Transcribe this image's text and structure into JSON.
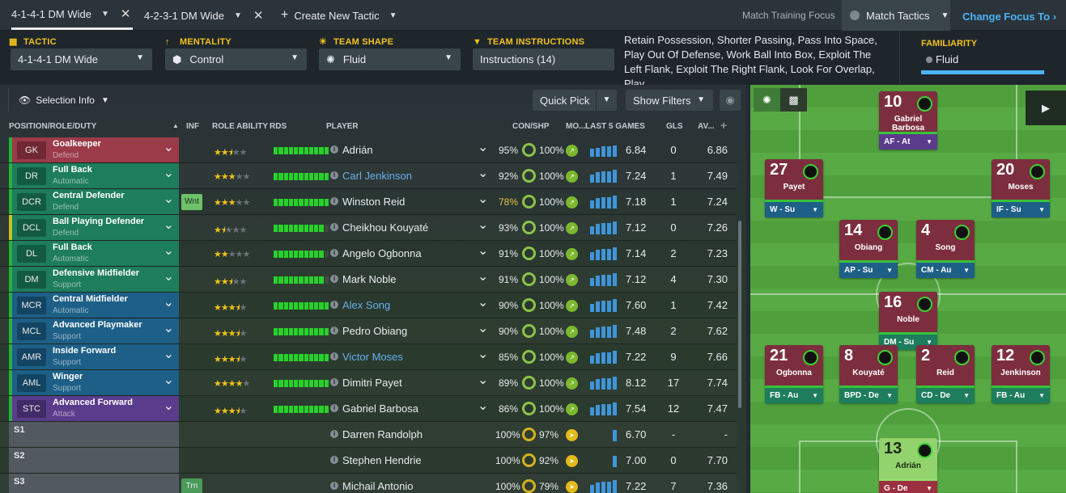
{
  "tabs": {
    "t1": "4-1-4-1 DM Wide",
    "t2": "4-2-3-1 DM Wide",
    "new": "Create New Tactic",
    "mtf": "Match Training Focus",
    "mtac": "Match Tactics",
    "change_focus": "Change Focus To"
  },
  "settings": {
    "tactic_label": "TACTIC",
    "tactic_value": "4-1-4-1 DM Wide",
    "mentality_label": "MENTALITY",
    "mentality_value": "Control",
    "shape_label": "TEAM SHAPE",
    "shape_value": "Fluid",
    "instr_label": "TEAM INSTRUCTIONS",
    "instr_value": "Instructions (14)",
    "instr_text": "Retain Possession, Shorter Passing, Pass Into Space, Play Out Of Defense, Work Ball Into Box, Exploit The Left Flank, Exploit The Right Flank, Look For Overlap, Play...",
    "familiarity_label": "FAMILIARITY",
    "familiarity_value": "Fluid"
  },
  "toolbar": {
    "selection_info": "Selection Info",
    "quick_pick": "Quick Pick",
    "show_filters": "Show Filters"
  },
  "columns": {
    "pos": "POSITION/ROLE/DUTY",
    "inf": "INF",
    "ra": "ROLE ABILITY",
    "rds": "RDS",
    "player": "PLAYER",
    "conshp": "CON/SHP",
    "mo": "MO...",
    "last5": "LAST 5 GAMES",
    "gls": "GLS",
    "av": "AV..."
  },
  "rows": [
    {
      "code": "GK",
      "role": "Goalkeeper",
      "duty": "Defend",
      "stars": 2.5,
      "rds": 1.0,
      "name": "Adrián",
      "con": "95%",
      "shp": "100%",
      "form": [
        0.6,
        0.7,
        0.8,
        0.8,
        0.9
      ],
      "avg": "6.84",
      "gls": "0",
      "av": "6.86",
      "color": "#9b3a48",
      "strip": "#27b33b"
    },
    {
      "code": "DR",
      "role": "Full Back",
      "duty": "Automatic",
      "stars": 3,
      "rds": 1.0,
      "name": "Carl Jenkinson",
      "loan": true,
      "con": "92%",
      "shp": "100%",
      "form": [
        0.6,
        0.8,
        0.9,
        0.9,
        1.0
      ],
      "avg": "7.24",
      "gls": "1",
      "av": "7.49",
      "color": "#1d7d5c",
      "strip": "#27b33b"
    },
    {
      "code": "DCR",
      "role": "Central Defender",
      "duty": "Defend",
      "stars": 3,
      "rds": 1.0,
      "name": "Winston Reid",
      "con": "78%",
      "con_warn": true,
      "shp": "100%",
      "form": [
        0.6,
        0.8,
        0.9,
        0.9,
        1.0
      ],
      "avg": "7.18",
      "gls": "1",
      "av": "7.24",
      "color": "#1d7d5c",
      "strip": "#27b33b",
      "inf": "Wnt"
    },
    {
      "code": "DCL",
      "role": "Ball Playing Defender",
      "duty": "Defend",
      "stars": 1.5,
      "rds": 0.82,
      "name": "Cheikhou Kouyaté",
      "con": "93%",
      "shp": "100%",
      "form": [
        0.6,
        0.8,
        0.9,
        0.9,
        1.0
      ],
      "avg": "7.12",
      "gls": "0",
      "av": "7.26",
      "color": "#1d7d5c",
      "strip": "#c7c21f"
    },
    {
      "code": "DL",
      "role": "Full Back",
      "duty": "Automatic",
      "stars": 2,
      "rds": 0.82,
      "name": "Angelo Ogbonna",
      "con": "91%",
      "shp": "100%",
      "form": [
        0.6,
        0.8,
        0.9,
        0.9,
        1.0
      ],
      "avg": "7.14",
      "gls": "2",
      "av": "7.23",
      "color": "#1d7d5c",
      "strip": "#27b33b"
    },
    {
      "code": "DM",
      "role": "Defensive Midfielder",
      "duty": "Support",
      "stars": 2.5,
      "rds": 0.82,
      "name": "Mark Noble",
      "con": "91%",
      "shp": "100%",
      "form": [
        0.6,
        0.8,
        0.9,
        0.9,
        1.0
      ],
      "avg": "7.12",
      "gls": "4",
      "av": "7.30",
      "color": "#1d7d5c",
      "strip": "#27b33b"
    },
    {
      "code": "MCR",
      "role": "Central Midfielder",
      "duty": "Automatic",
      "stars": 3.5,
      "rds": 1.0,
      "name": "Alex Song",
      "loan": true,
      "con": "90%",
      "shp": "100%",
      "form": [
        0.6,
        0.8,
        0.9,
        0.9,
        1.0
      ],
      "avg": "7.60",
      "gls": "1",
      "av": "7.42",
      "color": "#1d5f87",
      "strip": "#27b33b"
    },
    {
      "code": "MCL",
      "role": "Advanced Playmaker",
      "duty": "Support",
      "stars": 3.5,
      "rds": 1.0,
      "name": "Pedro Obiang",
      "con": "90%",
      "shp": "100%",
      "form": [
        0.6,
        0.8,
        0.9,
        0.9,
        1.0
      ],
      "avg": "7.48",
      "gls": "2",
      "av": "7.62",
      "color": "#1d5f87",
      "strip": "#27b33b"
    },
    {
      "code": "AMR",
      "role": "Inside Forward",
      "duty": "Support",
      "stars": 3.5,
      "rds": 1.0,
      "name": "Victor Moses",
      "loan": true,
      "con": "85%",
      "shp": "100%",
      "form": [
        0.6,
        0.8,
        0.9,
        0.9,
        1.0
      ],
      "avg": "7.22",
      "gls": "9",
      "av": "7.66",
      "color": "#1d5f87",
      "strip": "#27b33b"
    },
    {
      "code": "AML",
      "role": "Winger",
      "duty": "Support",
      "stars": 4,
      "rds": 1.0,
      "name": "Dimitri Payet",
      "con": "89%",
      "shp": "100%",
      "form": [
        0.6,
        0.8,
        0.9,
        0.9,
        1.0
      ],
      "avg": "8.12",
      "gls": "17",
      "av": "7.74",
      "color": "#1d5f87",
      "strip": "#27b33b"
    },
    {
      "code": "STC",
      "role": "Advanced Forward",
      "duty": "Attack",
      "stars": 3.5,
      "rds": 1.0,
      "name": "Gabriel Barbosa",
      "con": "86%",
      "shp": "100%",
      "form": [
        0.6,
        0.8,
        0.9,
        0.9,
        1.0
      ],
      "avg": "7.54",
      "gls": "12",
      "av": "7.47",
      "color": "#5b3b8c",
      "strip": "#27b33b"
    },
    {
      "sub": "S1",
      "name": "Darren Randolph",
      "con": "100%",
      "shp": "97%",
      "yellow": true,
      "form": [
        0,
        0,
        0,
        0,
        0.9
      ],
      "avg": "6.70",
      "gls": "-",
      "av": "-"
    },
    {
      "sub": "S2",
      "name": "Stephen Hendrie",
      "con": "100%",
      "shp": "92%",
      "yellow": true,
      "form": [
        0,
        0,
        0,
        0,
        0.9
      ],
      "avg": "7.00",
      "gls": "0",
      "av": "7.70"
    },
    {
      "sub": "S3",
      "name": "Michail Antonio",
      "con": "100%",
      "shp": "79%",
      "yellow": true,
      "form": [
        0.6,
        0.8,
        0.9,
        0.9,
        1.0
      ],
      "avg": "7.22",
      "gls": "7",
      "av": "7.36",
      "inf": "Trn"
    }
  ],
  "pitch": {
    "cards": [
      {
        "num": "10",
        "name": "Gabriel Barbosa",
        "role": "AF - At",
        "rb": "#5b3b8c"
      },
      {
        "num": "27",
        "name": "Payet",
        "role": "W - Su",
        "rb": "#1d5f87"
      },
      {
        "num": "20",
        "name": "Moses",
        "role": "IF - Su",
        "rb": "#1d5f87"
      },
      {
        "num": "14",
        "name": "Obiang",
        "role": "AP - Su",
        "rb": "#1d5f87"
      },
      {
        "num": "4",
        "name": "Song",
        "role": "CM - Au",
        "rb": "#1d5f87"
      },
      {
        "num": "16",
        "name": "Noble",
        "role": "DM - Su",
        "rb": "#1d7d5c"
      },
      {
        "num": "21",
        "name": "Ogbonna",
        "role": "FB - Au",
        "rb": "#1d7d5c"
      },
      {
        "num": "8",
        "name": "Kouyaté",
        "role": "BPD - De",
        "rb": "#1d7d5c"
      },
      {
        "num": "2",
        "name": "Reid",
        "role": "CD - De",
        "rb": "#1d7d5c"
      },
      {
        "num": "12",
        "name": "Jenkinson",
        "role": "FB - Au",
        "rb": "#1d7d5c"
      },
      {
        "num": "13",
        "name": "Adrián",
        "role": "G - De",
        "rb": "#9c3040",
        "gk": true
      }
    ]
  }
}
